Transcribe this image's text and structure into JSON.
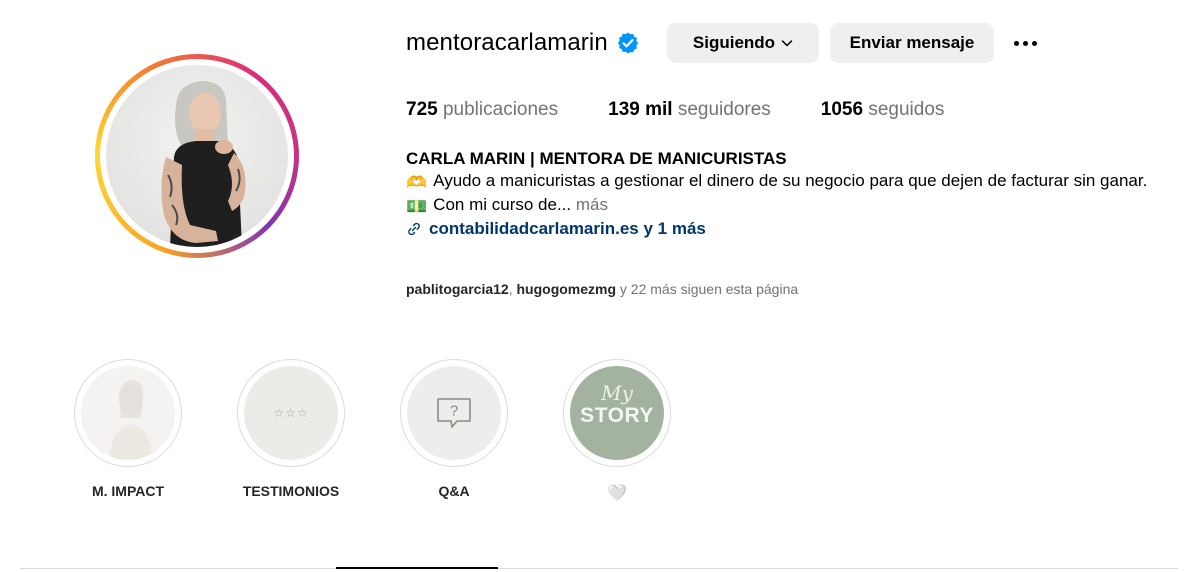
{
  "profile": {
    "username": "mentoracarlamarin",
    "verified_icon": "verified-badge-icon",
    "follow_button": "Siguiendo",
    "message_button": "Enviar mensaje",
    "more_icon": "more-options-icon"
  },
  "stats": {
    "posts_count": "725",
    "posts_label": "publicaciones",
    "followers_count": "139 mil",
    "followers_label": "seguidores",
    "following_count": "1056",
    "following_label": "seguidos"
  },
  "bio": {
    "name": "CARLA MARIN | MENTORA DE MANICURISTAS",
    "line1_emoji": "🫶",
    "line1": "Ayudo a manicuristas a gestionar el dinero de su negocio para que dejen de facturar sin ganar.",
    "line2_emoji": "💵",
    "line2": "Con mi curso de...",
    "more": "más",
    "link_icon": "link-icon",
    "link": "contabilidadcarlamarin.es y 1 más"
  },
  "followed_by": {
    "user1": "pablitogarcia12",
    "separator": ", ",
    "user2": "hugogomezmg",
    "rest": " y 22 más siguen esta página"
  },
  "highlights": [
    {
      "label": "M. IMPACT"
    },
    {
      "label": "TESTIMONIOS",
      "stars": "☆☆☆"
    },
    {
      "label": "Q&A",
      "icon": "question-bubble-icon",
      "glyph": "?"
    },
    {
      "label": "🤍",
      "cover_script": "My",
      "cover_text": "STORY"
    }
  ],
  "colors": {
    "link": "#00376b",
    "muted": "#737373",
    "button_bg": "#efefef",
    "verified": "#0095f6",
    "story_green": "#a3b3a0"
  }
}
